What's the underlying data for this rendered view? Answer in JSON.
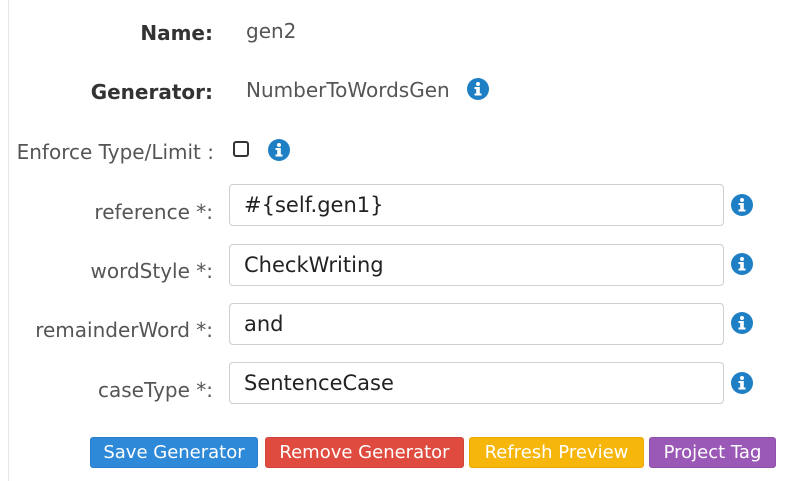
{
  "form": {
    "name": {
      "label": "Name:",
      "value": "gen2"
    },
    "generator": {
      "label": "Generator:",
      "value": "NumberToWordsGen",
      "info_icon": "info-icon"
    },
    "enforce": {
      "label": "Enforce Type/Limit :",
      "checked": false,
      "info_icon": "info-icon"
    },
    "fields": [
      {
        "label": "reference *:",
        "value": "#{self.gen1}"
      },
      {
        "label": "wordStyle *:",
        "value": "CheckWriting"
      },
      {
        "label": "remainderWord *:",
        "value": "and"
      },
      {
        "label": "caseType *:",
        "value": "SentenceCase"
      }
    ]
  },
  "buttons": {
    "save": "Save Generator",
    "remove": "Remove Generator",
    "refresh": "Refresh Preview",
    "tag": "Project Tag"
  },
  "colors": {
    "info": "#1f7fc4",
    "save": "#2e8ad8",
    "remove": "#e04b3f",
    "refresh": "#f6b60b",
    "tag": "#9a59b6"
  }
}
